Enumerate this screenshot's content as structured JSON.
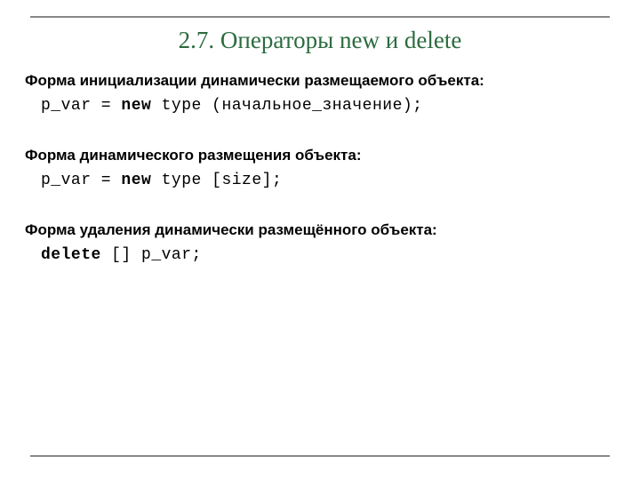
{
  "title": "2.7. Операторы new и delete",
  "sections": [
    {
      "heading": "Форма инициализации динамически размещаемого объекта:",
      "code_prefix": "p_var = ",
      "code_kw": "new",
      "code_suffix": " type (начальное_значение);"
    },
    {
      "heading": "Форма динамического размещения объекта:",
      "code_prefix": "p_var = ",
      "code_kw": "new",
      "code_suffix": " type [size];"
    },
    {
      "heading": "Форма удаления динамически размещённого объекта:",
      "code_prefix": "",
      "code_kw": "delete",
      "code_suffix": " [] p_var;"
    }
  ]
}
